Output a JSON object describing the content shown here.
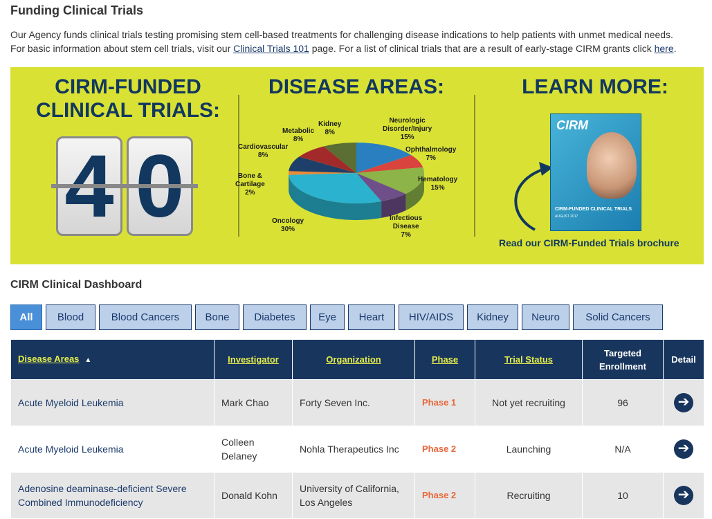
{
  "page": {
    "title": "Funding Clinical Trials",
    "intro_line1": "Our Agency funds clinical trials testing promising stem cell-based treatments for challenging disease indications to help patients with unmet medical needs.",
    "intro_line2_a": "For basic information about stem cell trials, visit our ",
    "intro_link1": "Clinical Trials 101",
    "intro_line2_b": " page. For a list of clinical trials that are a result of early-stage CIRM grants click ",
    "intro_link2": "here",
    "intro_line2_c": "."
  },
  "banner": {
    "heading1_line1": "CIRM-FUNDED",
    "heading1_line2": "CLINICAL TRIALS:",
    "counter_digit1": "4",
    "counter_digit2": "0",
    "heading2": "DISEASE AREAS:",
    "heading3": "LEARN MORE:",
    "brochure_logo": "CIRM",
    "brochure_title": "CIRM-FUNDED CLINICAL TRIALS",
    "brochure_date": "AUGUST 2017",
    "brochure_link": "Read our CIRM-Funded Trials brochure",
    "pie": [
      {
        "name": "Neurologic Disorder/Injury",
        "line1": "Neurologic",
        "line2": "Disorder/Injury",
        "pct": "15%",
        "value": 15,
        "color": "#2a7fc1"
      },
      {
        "name": "Ophthalmology",
        "line1": "Ophthalmology",
        "line2": "",
        "pct": "7%",
        "value": 7,
        "color": "#d9443f"
      },
      {
        "name": "Hematology",
        "line1": "Hematology",
        "line2": "",
        "pct": "15%",
        "value": 15,
        "color": "#8cb448"
      },
      {
        "name": "Infectious Disease",
        "line1": "Infectious",
        "line2": "Disease",
        "pct": "7%",
        "value": 7,
        "color": "#6e4f8a"
      },
      {
        "name": "Oncology",
        "line1": "Oncology",
        "line2": "",
        "pct": "30%",
        "value": 30,
        "color": "#2ab2cf"
      },
      {
        "name": "Bone & Cartilage",
        "line1": "Bone &",
        "line2": "Cartilage",
        "pct": "2%",
        "value": 2,
        "color": "#ea8a3a"
      },
      {
        "name": "Cardiovascular",
        "line1": "Cardiovascular",
        "line2": "",
        "pct": "8%",
        "value": 8,
        "color": "#1f3f6b"
      },
      {
        "name": "Metabolic",
        "line1": "Metabolic",
        "line2": "",
        "pct": "8%",
        "value": 8,
        "color": "#a32a2a"
      },
      {
        "name": "Kidney",
        "line1": "Kidney",
        "line2": "",
        "pct": "8%",
        "value": 8,
        "color": "#5b6e34"
      }
    ]
  },
  "dashboard": {
    "title": "CIRM Clinical Dashboard",
    "filters": [
      "All",
      "Blood",
      "Blood Cancers",
      "Bone",
      "Diabetes",
      "Eye",
      "Heart",
      "HIV/AIDS",
      "Kidney",
      "Neuro",
      "Solid Cancers"
    ],
    "active_filter": "All",
    "columns": {
      "disease": "Disease Areas",
      "investigator": "Investigator",
      "organization": "Organization",
      "phase": "Phase",
      "status": "Trial Status",
      "enrollment_1": "Targeted",
      "enrollment_2": "Enrollment",
      "detail": "Detail"
    },
    "rows": [
      {
        "disease": "Acute Myeloid Leukemia",
        "investigator": "Mark Chao",
        "organization": "Forty Seven Inc.",
        "phase": "Phase 1",
        "status": "Not yet recruiting",
        "enrollment": "96"
      },
      {
        "disease": "Acute Myeloid Leukemia",
        "investigator": "Colleen Delaney",
        "organization": "Nohla Therapeutics Inc",
        "phase": "Phase 2",
        "status": "Launching",
        "enrollment": "N/A"
      },
      {
        "disease": "Adenosine deaminase-deficient Severe Combined Immunodeficiency",
        "investigator": "Donald Kohn",
        "organization": "University of California, Los Angeles",
        "phase": "Phase 2",
        "status": "Recruiting",
        "enrollment": "10"
      }
    ]
  }
}
